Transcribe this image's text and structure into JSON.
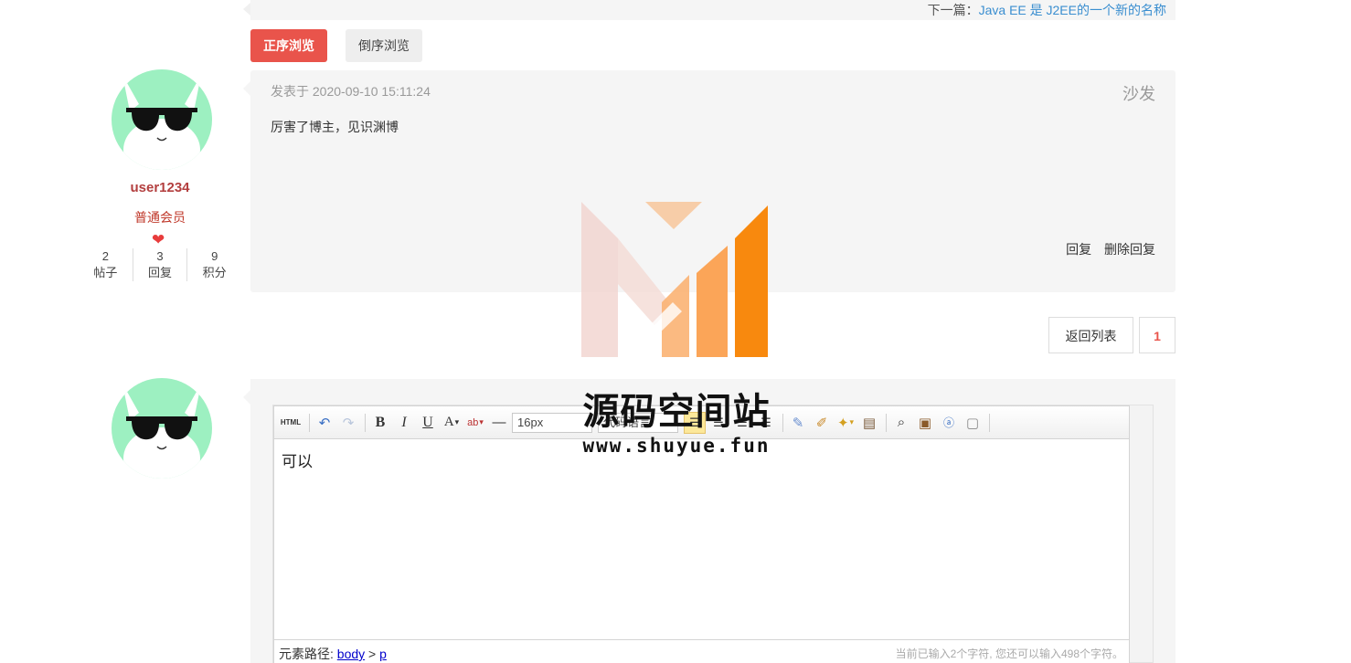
{
  "top_nav": {
    "next_prefix": "下一篇：",
    "next_title": "Java EE 是 J2EE的一个新的名称"
  },
  "order": {
    "asc_label": "正序浏览",
    "desc_label": "倒序浏览"
  },
  "user": {
    "name": "user1234",
    "role": "普通会员",
    "stats": [
      {
        "value": "2",
        "label": "帖子"
      },
      {
        "value": "3",
        "label": "回复"
      },
      {
        "value": "9",
        "label": "积分"
      }
    ]
  },
  "comment": {
    "time": "发表于 2020-09-10 15:11:24",
    "floor": "沙发",
    "body": "厉害了博主，见识渊博",
    "reply_label": "回复",
    "delete_label": "删除回复"
  },
  "pagination": {
    "back_label": "返回列表",
    "current_page": "1"
  },
  "editor": {
    "html_label": "HTML",
    "font_size": "16px",
    "code_lang": "代码语言",
    "content": "可以",
    "path_label": "元素路径: ",
    "path_body": "body",
    "path_sep": " > ",
    "path_p": "p",
    "count_text": "当前已输入2个字符, 您还可以输入498个字符。"
  },
  "watermark": {
    "name": "源码空间站",
    "url": "www.shuyue.fun"
  },
  "colors": {
    "accent": "#e9544b",
    "avatar_bg": "#9df0c1",
    "link": "#3a8ed0"
  }
}
